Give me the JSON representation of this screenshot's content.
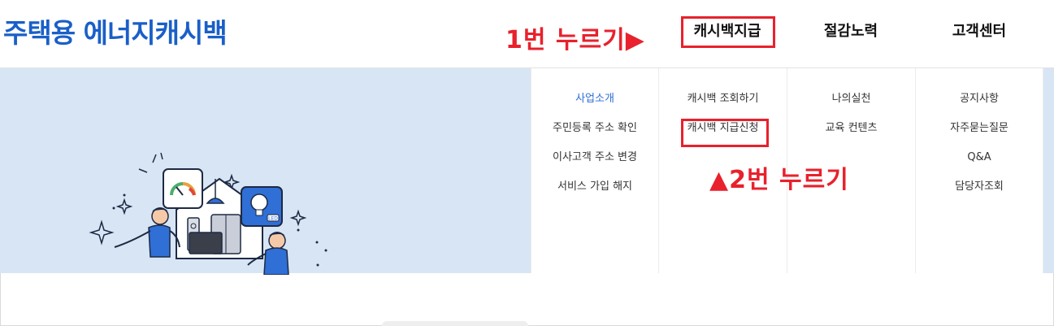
{
  "header": {
    "logo": "주택용 에너지캐시백",
    "nav": [
      {
        "label": "캐시백지급"
      },
      {
        "label": "절감노력"
      },
      {
        "label": "고객센터"
      }
    ]
  },
  "annotations": {
    "step1": "1번 누르기▶",
    "step2": "▲2번 누르기"
  },
  "menu": {
    "col1": [
      "사업소개",
      "주민등록 주소 확인",
      "이사고객 주소 변경",
      "서비스 가입 해지"
    ],
    "col2": [
      "캐시백 조회하기",
      "캐시백 지급신청"
    ],
    "col3": [
      "나의실천",
      "교육 컨텐츠"
    ],
    "col4": [
      "공지사항",
      "자주묻는질문",
      "Q&A",
      "담당자조회"
    ]
  },
  "illustration": {
    "badge": "LED"
  },
  "colors": {
    "brand": "#1a5fc8",
    "annotation": "#e8212d",
    "active_link": "#2d6ed6",
    "panel": "#d8e5f4"
  }
}
